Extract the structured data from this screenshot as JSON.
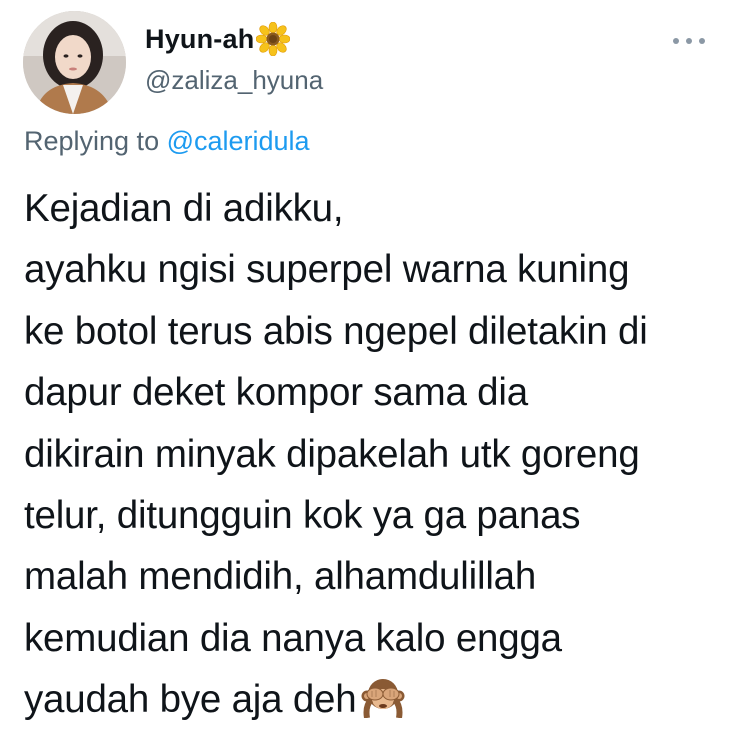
{
  "author": {
    "display_name": "Hyun-ah",
    "name_emoji": "sunflower-icon",
    "handle": "@zaliza_hyuna"
  },
  "reply": {
    "prefix": "Replying to ",
    "handle": "@caleridula"
  },
  "tweet": {
    "lines": [
      "Kejadian di adikku,",
      "ayahku ngisi superpel warna kuning",
      "ke botol terus abis ngepel diletakin di",
      "dapur deket kompor sama dia",
      "dikirain minyak dipakelah utk goreng",
      "telur, ditungguin kok ya ga panas",
      "malah mendidih, alhamdulillah",
      "kemudian dia nanya kalo engga",
      "yaudah bye aja deh"
    ],
    "trailing_emoji": "see-no-evil-monkey-icon"
  },
  "colors": {
    "text": "#0f1419",
    "secondary": "#536471",
    "link": "#1d9bf0"
  }
}
